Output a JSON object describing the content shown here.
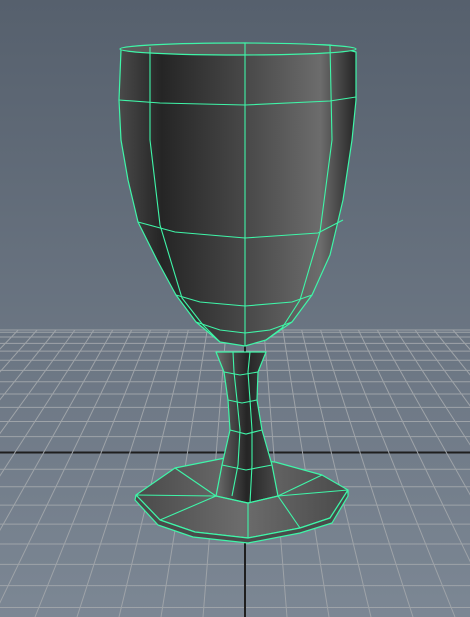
{
  "viewport": {
    "view": "perspective",
    "object": "goblet",
    "display_mode": "smooth-shade-with-wireframe-on-shaded",
    "selection_highlight": true
  },
  "colors": {
    "background_top": "#56606d",
    "background_bottom": "#7c8794",
    "grid_line": "#9ea3a8",
    "grid_axis": "#1e1e1e",
    "wireframe": "#3ff5a8",
    "surface_dark": "#252525",
    "surface_mid": "#4a4a4a",
    "surface_light": "#6c6c6c",
    "rim_inside": "#5c5c5c"
  }
}
